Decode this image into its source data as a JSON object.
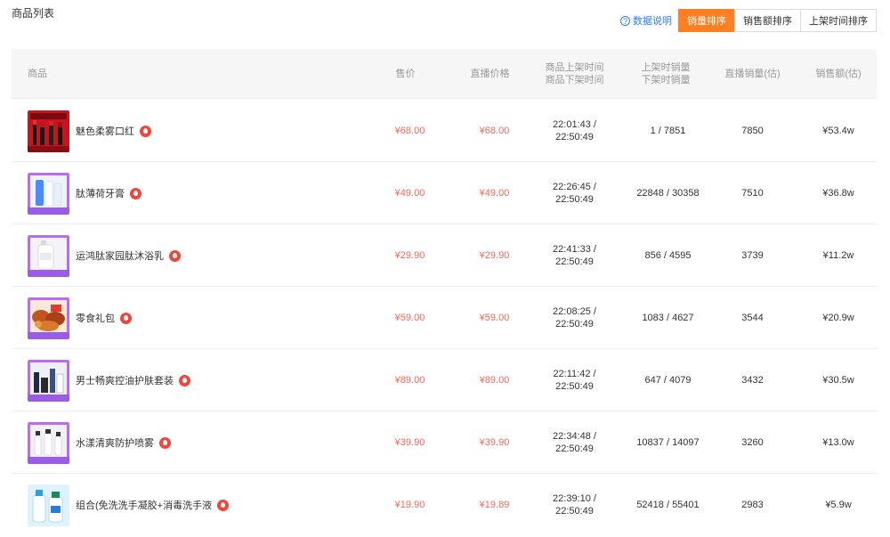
{
  "page_title": "商品列表",
  "toolbar": {
    "help_label": "数据说明",
    "sort_buttons": [
      {
        "label": "销量排序",
        "active": true
      },
      {
        "label": "销售额排序",
        "active": false
      },
      {
        "label": "上架时间排序",
        "active": false
      }
    ]
  },
  "columns": {
    "product": "商品",
    "price": "售价",
    "live_price": "直播价格",
    "time_line1": "商品上架时间",
    "time_line2": "商品下架时间",
    "sales_line1": "上架时销量",
    "sales_line2": "下架时销量",
    "live_sales": "直播销量(估)",
    "revenue": "销售额(估)"
  },
  "rows": [
    {
      "name": "魅色柔雾口红",
      "price": "¥68.00",
      "live_price": "¥68.00",
      "time_on": "22:01:43 /",
      "time_off": "22:50:49",
      "sales": "1 / 7851",
      "live_sales": "7850",
      "revenue": "¥53.4w",
      "thumb": "lipstick"
    },
    {
      "name": "肽薄荷牙膏",
      "price": "¥49.00",
      "live_price": "¥49.00",
      "time_on": "22:26:45 /",
      "time_off": "22:50:49",
      "sales": "22848 / 30358",
      "live_sales": "7510",
      "revenue": "¥36.8w",
      "thumb": "toothpaste"
    },
    {
      "name": "运鸿肽家园肽沐浴乳",
      "price": "¥29.90",
      "live_price": "¥29.90",
      "time_on": "22:41:33 /",
      "time_off": "22:50:49",
      "sales": "856 / 4595",
      "live_sales": "3739",
      "revenue": "¥11.2w",
      "thumb": "bodywash"
    },
    {
      "name": "零食礼包",
      "price": "¥59.00",
      "live_price": "¥59.00",
      "time_on": "22:08:25 /",
      "time_off": "22:50:49",
      "sales": "1083 / 4627",
      "live_sales": "3544",
      "revenue": "¥20.9w",
      "thumb": "snacks"
    },
    {
      "name": "男士畅爽控油护肤套装",
      "price": "¥89.00",
      "live_price": "¥89.00",
      "time_on": "22:11:42 /",
      "time_off": "22:50:49",
      "sales": "647 / 4079",
      "live_sales": "3432",
      "revenue": "¥30.5w",
      "thumb": "menskin"
    },
    {
      "name": "水漾清爽防护喷雾",
      "price": "¥39.90",
      "live_price": "¥39.90",
      "time_on": "22:34:48 /",
      "time_off": "22:50:49",
      "sales": "10837 / 14097",
      "live_sales": "3260",
      "revenue": "¥13.0w",
      "thumb": "spray"
    },
    {
      "name": "组合(免洗洗手凝胶+消毒洗手液",
      "price": "¥19.90",
      "live_price": "¥19.89",
      "time_on": "22:39:10 /",
      "time_off": "22:50:49",
      "sales": "52418 / 55401",
      "live_sales": "2983",
      "revenue": "¥5.9w",
      "thumb": "sanitizer"
    }
  ],
  "colors": {
    "accent": "#ff7f22",
    "price": "#f5675a",
    "link": "#2e7bff",
    "hot": "#f2463c"
  },
  "icons": {
    "help": "question-circle-icon",
    "hot": "flame-icon"
  }
}
